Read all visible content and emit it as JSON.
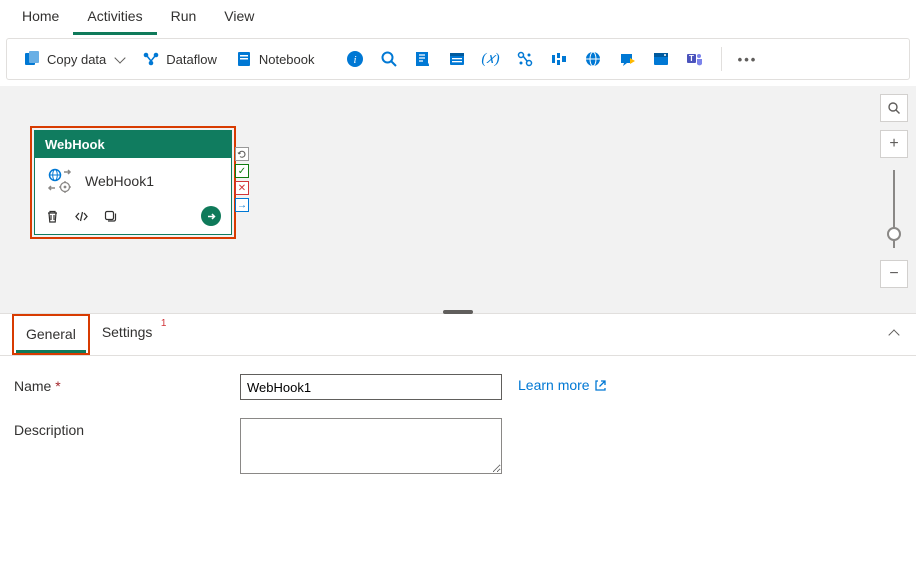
{
  "top_tabs": {
    "home": "Home",
    "activities": "Activities",
    "run": "Run",
    "view": "View"
  },
  "toolbar": {
    "copy_data": "Copy data",
    "dataflow": "Dataflow",
    "notebook": "Notebook"
  },
  "activity": {
    "type": "WebHook",
    "name": "WebHook1"
  },
  "props_tabs": {
    "general": "General",
    "settings": "Settings",
    "settings_badge": "1"
  },
  "form": {
    "name_label": "Name",
    "name_value": "WebHook1",
    "desc_label": "Description",
    "desc_value": "",
    "learn_more": "Learn more"
  }
}
